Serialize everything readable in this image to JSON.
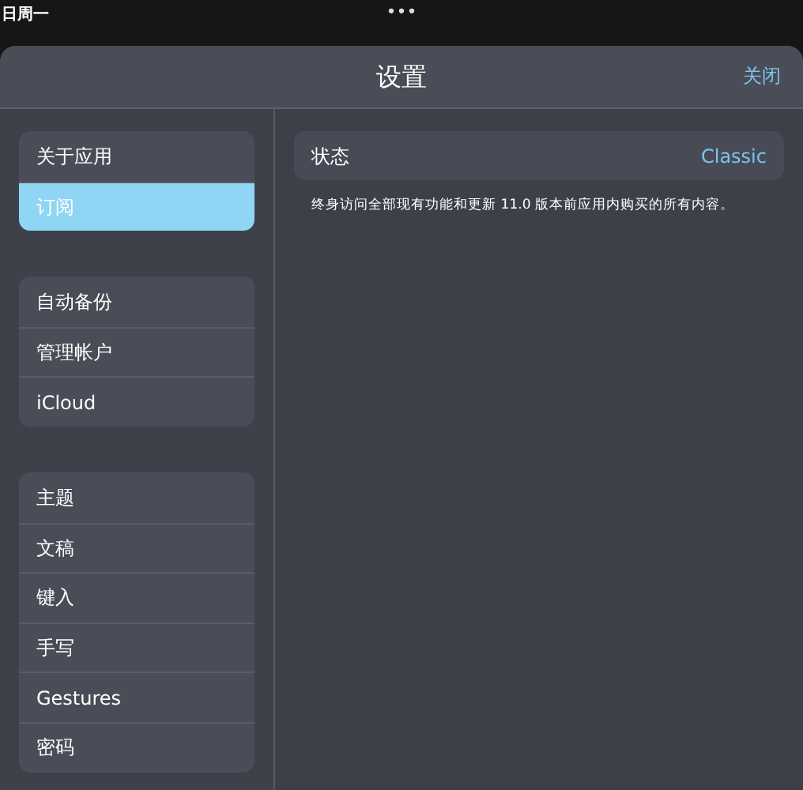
{
  "status_bar": {
    "date": "日周一",
    "dots": "•••"
  },
  "sheet": {
    "title": "设置",
    "close": "关闭"
  },
  "sidebar": {
    "groups": [
      {
        "items": [
          {
            "label": "关于应用",
            "selected": false
          },
          {
            "label": "订阅",
            "selected": true
          }
        ]
      },
      {
        "items": [
          {
            "label": "自动备份",
            "selected": false
          },
          {
            "label": "管理帐户",
            "selected": false
          },
          {
            "label": "iCloud",
            "selected": false
          }
        ]
      },
      {
        "items": [
          {
            "label": "主题",
            "selected": false
          },
          {
            "label": "文稿",
            "selected": false
          },
          {
            "label": "键入",
            "selected": false
          },
          {
            "label": "手写",
            "selected": false
          },
          {
            "label": "Gestures",
            "selected": false
          },
          {
            "label": "密码",
            "selected": false
          }
        ]
      }
    ]
  },
  "detail": {
    "row": {
      "label": "状态",
      "value": "Classic"
    },
    "description": "终身访问全部现有功能和更新 11.0 版本前应用内购买的所有内容。"
  }
}
